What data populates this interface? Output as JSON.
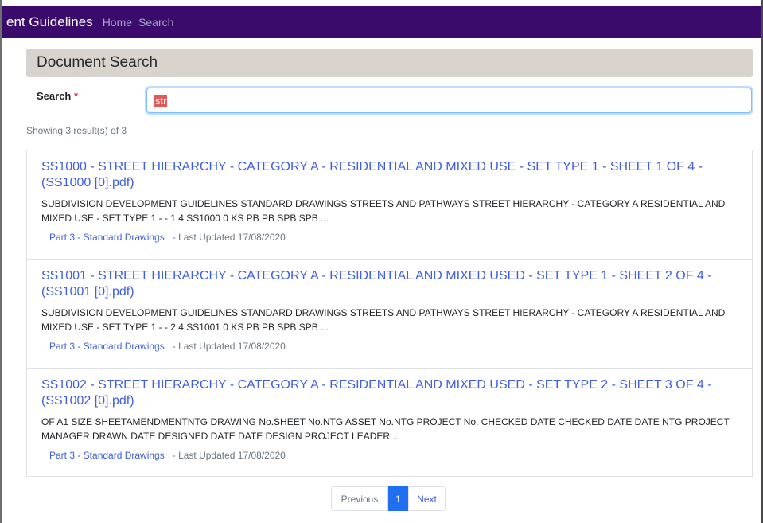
{
  "navbar": {
    "brand": "ent Guidelines",
    "links": [
      "Home",
      "Search"
    ]
  },
  "page": {
    "title": "Document Search"
  },
  "search": {
    "label": "Search",
    "required_mark": "*",
    "value": "str"
  },
  "results_summary": "Showing 3 result(s) of 3",
  "results": [
    {
      "title": "SS1000 - STREET HIERARCHY - CATEGORY A - RESIDENTIAL AND MIXED USE - SET TYPE 1 - SHEET 1 OF 4 - (SS1000 [0].pdf)",
      "snippet": "SUBDIVISION DEVELOPMENT GUIDELINES STANDARD DRAWINGS STREETS AND PATHWAYS STREET HIERARCHY - CATEGORY A RESIDENTIAL AND MIXED USE - SET TYPE 1 - - 1 4 SS1000 0 KS PB PB SPB SPB ...",
      "category": "Part 3 - Standard Drawings",
      "updated": "- Last Updated 17/08/2020"
    },
    {
      "title": "SS1001 - STREET HIERARCHY - CATEGORY A - RESIDENTIAL AND MIXED USED - SET TYPE 1 - SHEET 2 OF 4 - (SS1001 [0].pdf)",
      "snippet": "SUBDIVISION DEVELOPMENT GUIDELINES STANDARD DRAWINGS STREETS AND PATHWAYS STREET HIERARCHY - CATEGORY A RESIDENTIAL AND MIXED USE - SET TYPE 1 - - 2 4 SS1001 0 KS PB PB SPB SPB ...",
      "category": "Part 3 - Standard Drawings",
      "updated": "- Last Updated 17/08/2020"
    },
    {
      "title": "SS1002 - STREET HIERARCHY - CATEGORY A - RESIDENTIAL AND MIXED USED - SET TYPE 2 - SHEET 3 OF 4 - (SS1002 [0].pdf)",
      "snippet": "OF A1 SIZE SHEETAMENDMENTNTG DRAWING No.SHEET No.NTG ASSET No.NTG PROJECT No. CHECKED DATE CHECKED DATE DATE NTG PROJECT MANAGER DRAWN DATE DESIGNED DATE DATE DESIGN PROJECT LEADER ...",
      "category": "Part 3 - Standard Drawings",
      "updated": "- Last Updated 17/08/2020"
    }
  ],
  "pagination": {
    "previous": "Previous",
    "current": "1",
    "next": "Next"
  },
  "colors": {
    "navbar_bg": "#3b0b6b",
    "link": "#3f5ee0",
    "active_page": "#1f6ff0",
    "header_bg": "#d8d3cc",
    "required": "#dc3545"
  }
}
